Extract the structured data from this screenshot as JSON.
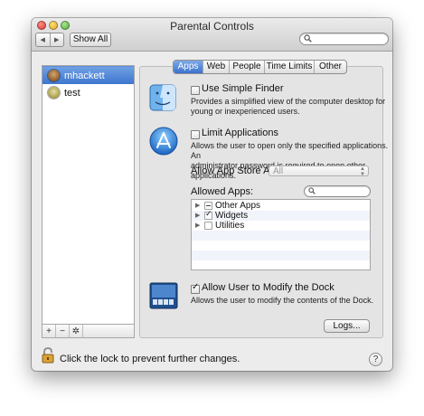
{
  "window": {
    "title": "Parental Controls"
  },
  "toolbar": {
    "back_glyph": "◀",
    "forward_glyph": "▶",
    "show_all_label": "Show All",
    "search_value": ""
  },
  "sidebar": {
    "users": [
      {
        "name": "mhackett",
        "selected": true,
        "icon": "user-avatar-icon"
      },
      {
        "name": "test",
        "selected": false,
        "icon": "user-avatar-icon"
      }
    ],
    "footer": {
      "add_glyph": "+",
      "remove_glyph": "−",
      "action_glyph": "✲"
    }
  },
  "tabs": [
    "Apps",
    "Web",
    "People",
    "Time Limits",
    "Other"
  ],
  "apps_tab": {
    "simple_finder": {
      "label": "Use Simple Finder",
      "checked": false,
      "desc_line1": "Provides a simplified view of the computer desktop for",
      "desc_line2": "young or inexperienced users.",
      "icon": "finder-icon"
    },
    "limit_apps": {
      "label": "Limit Applications",
      "checked": false,
      "desc_line1": "Allows the user to open only the specified applications. An",
      "desc_line2": "administrator password is required to open other applications.",
      "icon": "app-store-icon"
    },
    "app_store": {
      "label": "Allow App Store Apps:",
      "value": "All"
    },
    "allowed_apps": {
      "label": "Allowed Apps:",
      "search_value": "",
      "items": [
        {
          "name": "Other Apps",
          "state": "mixed"
        },
        {
          "name": "Widgets",
          "state": "checked"
        },
        {
          "name": "Utilities",
          "state": "unchecked"
        }
      ]
    },
    "dock": {
      "label": "Allow User to Modify the Dock",
      "checked": true,
      "desc": "Allows the user to modify the contents of the Dock.",
      "icon": "dock-icon"
    },
    "logs_label": "Logs..."
  },
  "footer": {
    "lock_text": "Click the lock to prevent further changes.",
    "help_glyph": "?"
  },
  "colors": {
    "selection": "#3e76cf",
    "window_bg": "#ececec",
    "list_alt_row": "#f1f4fa"
  }
}
